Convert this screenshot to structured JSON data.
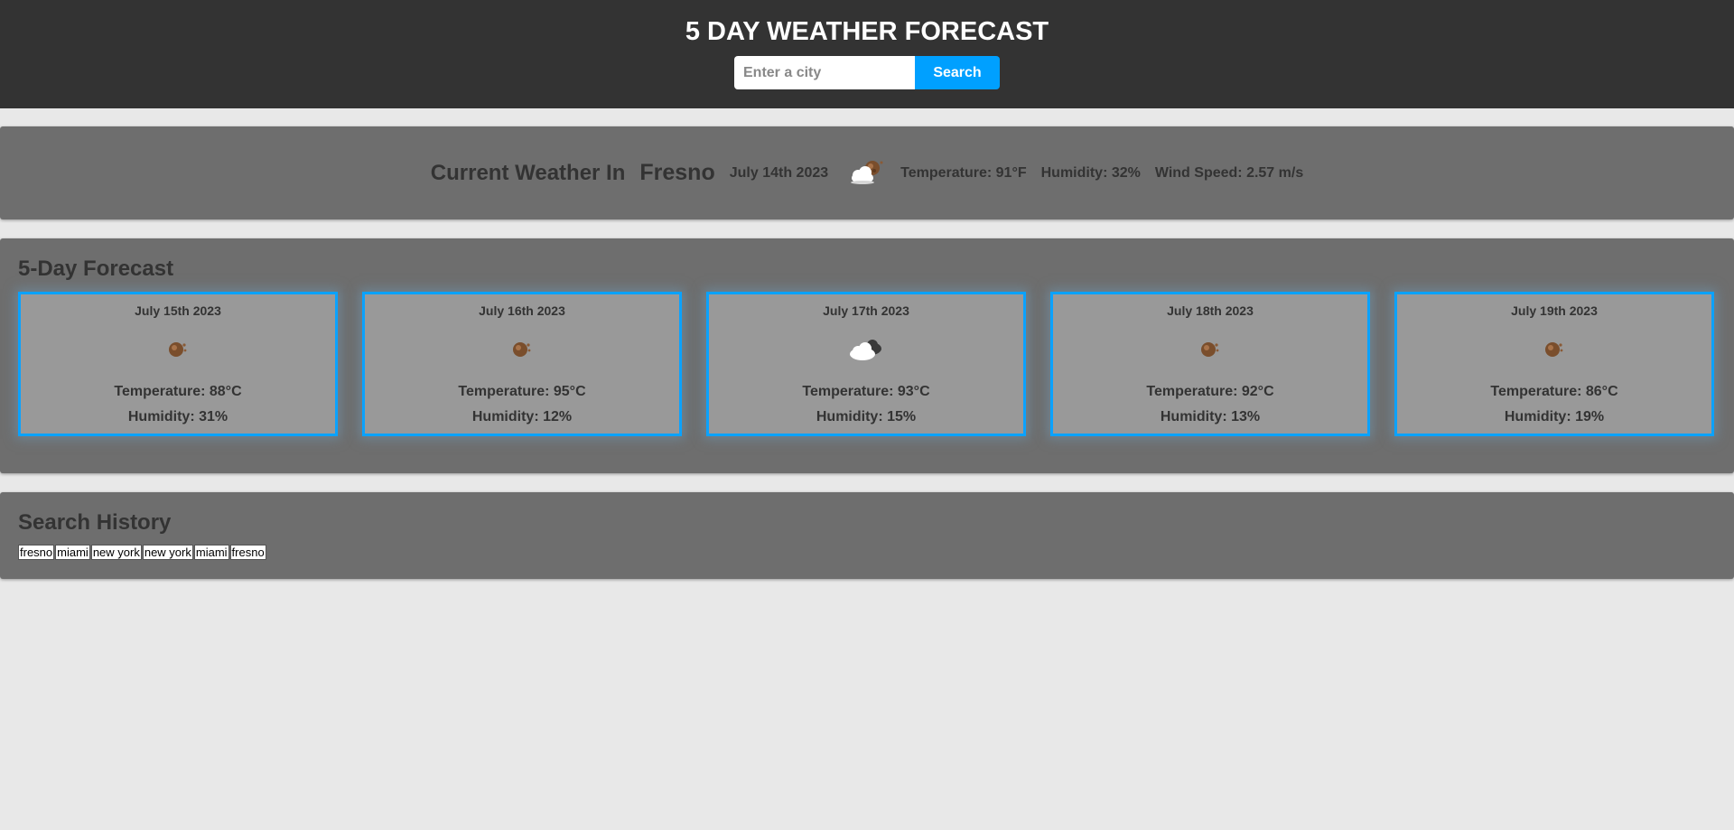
{
  "header": {
    "title": "5 DAY WEATHER FORECAST",
    "search_placeholder": "Enter a city",
    "search_value": "",
    "search_label": "Search"
  },
  "current": {
    "heading": "Current Weather In",
    "city": "Fresno",
    "date": "July 14th 2023",
    "icon": "partly-cloudy-icon",
    "temperature": "Temperature: 91°F",
    "humidity": "Humidity: 32%",
    "wind": "Wind Speed: 2.57 m/s"
  },
  "forecast": {
    "title": "5-Day Forecast",
    "days": [
      {
        "date": "July 15th 2023",
        "icon": "clear-sun-icon",
        "temperature": "Temperature: 88°C",
        "humidity": "Humidity: 31%"
      },
      {
        "date": "July 16th 2023",
        "icon": "clear-sun-icon",
        "temperature": "Temperature: 95°C",
        "humidity": "Humidity: 12%"
      },
      {
        "date": "July 17th 2023",
        "icon": "cloudy-icon",
        "temperature": "Temperature: 93°C",
        "humidity": "Humidity: 15%"
      },
      {
        "date": "July 18th 2023",
        "icon": "clear-sun-icon",
        "temperature": "Temperature: 92°C",
        "humidity": "Humidity: 13%"
      },
      {
        "date": "July 19th 2023",
        "icon": "clear-sun-icon",
        "temperature": "Temperature: 86°C",
        "humidity": "Humidity: 19%"
      }
    ]
  },
  "history": {
    "title": "Search History",
    "items": [
      "fresno",
      "miami",
      "new york",
      "new york",
      "miami",
      "fresno"
    ]
  },
  "colors": {
    "header_bg": "#333333",
    "page_bg": "#e8e8e8",
    "panel_bg": "#6e6e6e",
    "card_bg": "#999999",
    "accent": "#00a0ff"
  }
}
